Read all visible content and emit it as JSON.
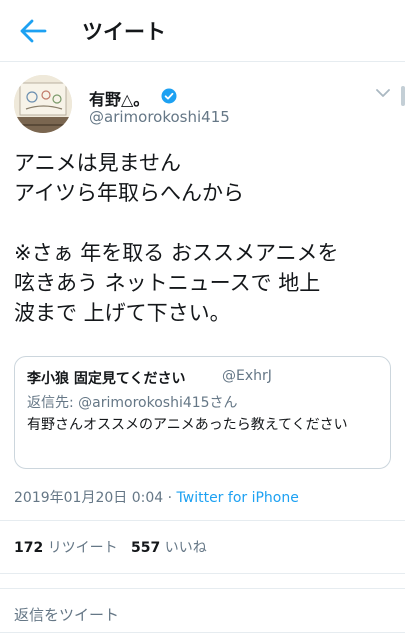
{
  "header": {
    "title": "ツイート"
  },
  "tweet": {
    "author_name": "有野△。",
    "author_handle": "@arimorokoshi415",
    "lines": [
      "アニメは見ません",
      "アイツら年取らへんから",
      "",
      "※さぁ 年を取る おススメアニメを",
      "呟きあう ネットニュースで 地上",
      "波まで 上げて下さい。"
    ],
    "quote": {
      "name": "李小狼  固定見てください",
      "handle": "@ExhrJ",
      "reply_to": "返信先: @arimorokoshi415さん",
      "text": "有野さんオススメのアニメあったら教えてください"
    },
    "date": "2019年01月20日 0:04",
    "separator": "·",
    "source": "Twitter for iPhone",
    "retweets": "172",
    "retweets_label": "リツイート",
    "likes": "557",
    "likes_label": "いいね"
  },
  "reply": {
    "placeholder": "返信をツイート"
  },
  "colors": {
    "accent": "#1da1f2",
    "secondary": "#657786",
    "border": "#e6ecf0"
  },
  "icons": [
    "back-arrow-icon",
    "verified-badge-icon",
    "chevron-down-icon"
  ]
}
